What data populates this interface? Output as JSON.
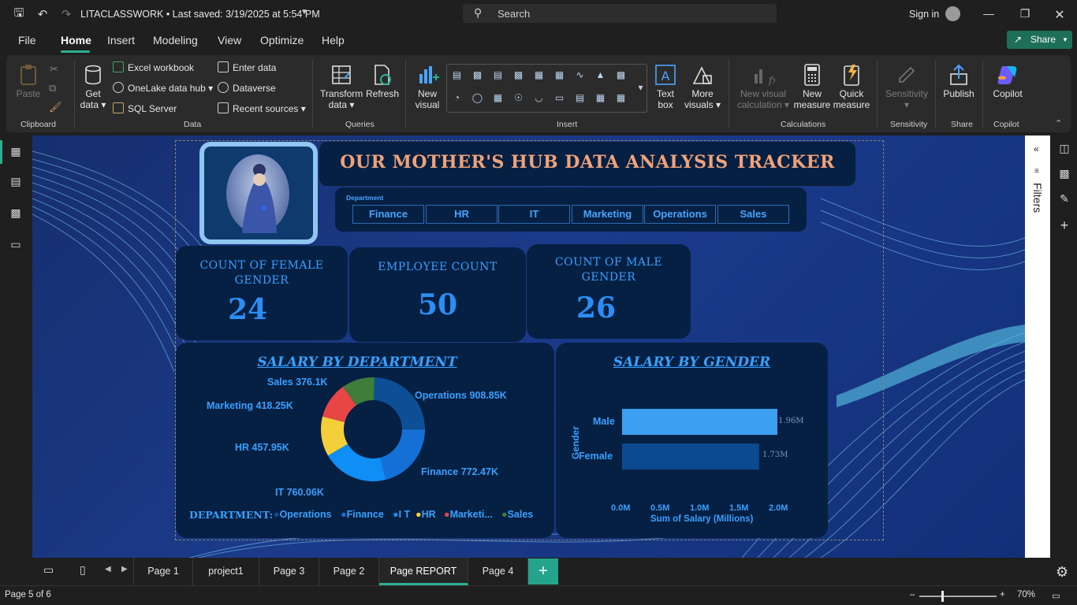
{
  "titlebar": {
    "file_name_status": "LITACLASSWORK • Last saved: 3/19/2025 at 5:54 PM",
    "search_placeholder": "Search",
    "sign_in": "Sign in"
  },
  "menu": {
    "items": [
      "File",
      "Home",
      "Insert",
      "Modeling",
      "View",
      "Optimize",
      "Help"
    ],
    "active": "Home",
    "share_label": "Share"
  },
  "ribbon": {
    "clipboard": {
      "paste": "Paste",
      "group": "Clipboard"
    },
    "data": {
      "get_data_1": "Get",
      "get_data_2": "data",
      "excel": "Excel workbook",
      "onelake": "OneLake data hub",
      "sql": "SQL Server",
      "enter_data": "Enter data",
      "dataverse": "Dataverse",
      "recent": "Recent sources",
      "group": "Data"
    },
    "queries": {
      "transform_1": "Transform",
      "transform_2": "data",
      "refresh": "Refresh",
      "group": "Queries"
    },
    "insert": {
      "new_visual_1": "New",
      "new_visual_2": "visual",
      "text_box_1": "Text",
      "text_box_2": "box",
      "more_visuals_1": "More",
      "more_visuals_2": "visuals",
      "group": "Insert"
    },
    "calculations": {
      "new_visual_calc_1": "New visual",
      "new_visual_calc_2": "calculation",
      "new_measure_1": "New",
      "new_measure_2": "measure",
      "quick_measure_1": "Quick",
      "quick_measure_2": "measure",
      "group": "Calculations"
    },
    "sensitivity": {
      "label": "Sensitivity",
      "group": "Sensitivity"
    },
    "share": {
      "publish": "Publish",
      "group": "Share"
    },
    "copilot": {
      "label": "Copilot",
      "group": "Copilot"
    }
  },
  "report": {
    "title": "OUR MOTHER'S HUB DATA ANALYSIS TRACKER",
    "slicer": {
      "label": "Department",
      "options": [
        "Finance",
        "HR",
        "IT",
        "Marketing",
        "Operations",
        "Sales"
      ]
    },
    "kpis": [
      {
        "title": "COUNT OF FEMALE GENDER",
        "value": "24"
      },
      {
        "title": "EMPLOYEE COUNT",
        "value": "50"
      },
      {
        "title": "COUNT OF MALE GENDER",
        "value": "26"
      }
    ]
  },
  "chart_data": [
    {
      "type": "pie",
      "title": "SALARY BY DEPARTMENT",
      "legend_title": "DEPARTMENT:",
      "legend_placement": "bottom",
      "slices": [
        {
          "name": "Operations",
          "value": 908.85,
          "label": "Operations 908.85K",
          "legend": "Operations",
          "color": "#0d4f95"
        },
        {
          "name": "Finance",
          "value": 772.47,
          "label": "Finance 772.47K",
          "legend": "Finance",
          "color": "#1570d6"
        },
        {
          "name": "IT",
          "value": 760.06,
          "label": "IT 760.06K",
          "legend": "I T",
          "color": "#0f8ef5"
        },
        {
          "name": "HR",
          "value": 457.95,
          "label": "HR 457.95K",
          "legend": "HR",
          "color": "#f5cf3a"
        },
        {
          "name": "Marketing",
          "value": 418.25,
          "label": "Marketing 418.25K",
          "legend": "Marketi...",
          "color": "#e84545"
        },
        {
          "name": "Sales",
          "value": 376.1,
          "label": "Sales 376.1K",
          "legend": "Sales",
          "color": "#3e7d3a"
        }
      ]
    },
    {
      "type": "bar",
      "orientation": "horizontal",
      "title": "SALARY BY GENDER",
      "categories": [
        "Male",
        "Female"
      ],
      "values": [
        1.96,
        1.73
      ],
      "data_labels": [
        "1.96M",
        "1.73M"
      ],
      "colors": [
        "#3d9ff0",
        "#0c4a8f"
      ],
      "xlabel": "Sum of Salary (Millions)",
      "ylabel": "Gender",
      "xticks": [
        "0.0M",
        "0.5M",
        "1.0M",
        "1.5M",
        "2.0M"
      ],
      "xlim": [
        0,
        2.0
      ]
    }
  ],
  "tabs": {
    "pages": [
      "Page 1",
      "project1",
      "Page 3",
      "Page 2",
      "Page REPORT",
      "Page 4"
    ],
    "active": "Page REPORT"
  },
  "status": {
    "page_info": "Page 5 of 6",
    "zoom": "70%"
  },
  "filters_label": "Filters"
}
